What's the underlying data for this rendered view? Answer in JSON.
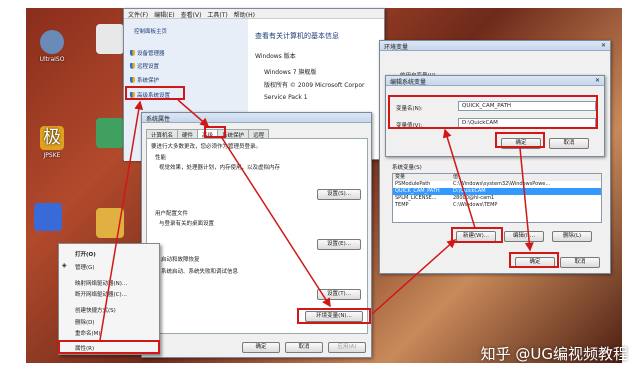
{
  "desktop_icons": [
    {
      "label": "UltraISO",
      "color": "#6a8ab8"
    },
    {
      "label": "JPSKE",
      "color": "#e0a020"
    },
    {
      "label": "",
      "color": "#3a6ad8"
    },
    {
      "label": "",
      "color": "#e8e8e8"
    },
    {
      "label": "",
      "color": "#40a060"
    },
    {
      "label": "",
      "color": "#e0b040"
    }
  ],
  "control_panel": {
    "menu": [
      "文件(F)",
      "编辑(E)",
      "查看(V)",
      "工具(T)",
      "帮助(H)"
    ],
    "nav": [
      "控制面板主页",
      "设备管理器",
      "远程设置",
      "系统保护",
      "高级系统设置"
    ],
    "heading": "查看有关计算机的基本信息",
    "edition_label": "Windows 版本",
    "edition": "Windows 7 旗舰版",
    "copyright": "版权所有 © 2009 Microsoft Corpor",
    "service_pack": "Service Pack 1"
  },
  "system_properties": {
    "title": "系统属性",
    "tabs": [
      "计算机名",
      "硬件",
      "高级",
      "系统保护",
      "远程"
    ],
    "admin_note": "要进行大多数更改，您必须作为管理员登录。",
    "perf_title": "性能",
    "perf_desc": "视觉效果，处理器计划，内存使用，以及虚拟内存",
    "settings1": "设置(S)...",
    "profile_title": "用户配置文件",
    "profile_desc": "与登录有关的桌面设置",
    "settings2": "设置(E)...",
    "startup_title": "启动和故障恢复",
    "startup_desc": "系统启动、系统失败和调试信息",
    "settings3": "设置(T)...",
    "env_button": "环境变量(N)...",
    "ok": "确定",
    "cancel": "取消",
    "apply": "应用(A)"
  },
  "env_vars": {
    "title": "环境变量",
    "user_vars_label": "的用户变量(U)",
    "system_vars_label": "系统变量(S)",
    "col_var": "变量",
    "col_val": "值",
    "rows": [
      {
        "name": "PSModulePath",
        "value": "C:\\Windows\\system32\\WindowsPowe..."
      },
      {
        "name": "QUICK_CAM_PATH",
        "value": "D:\\QuickCAM"
      },
      {
        "name": "SPLM_LICENSE...",
        "value": "28000@hl-cam1"
      },
      {
        "name": "TEMP",
        "value": "C:\\Windows\\TEMP"
      }
    ],
    "new_btn": "新建(W)...",
    "edit_btn": "编辑(I)...",
    "delete_btn": "删除(L)",
    "ok": "确定",
    "cancel": "取消"
  },
  "edit_var": {
    "title": "编辑系统变量",
    "name_label": "变量名(N):",
    "name_value": "QUICK_CAM_PATH",
    "value_label": "变量值(V):",
    "value_value": "D:\\QuickCAM",
    "ok": "确定",
    "cancel": "取消"
  },
  "context_menu": {
    "items": [
      "打开(O)",
      "管理(G)",
      "映射网络驱动器(N)...",
      "断开网络驱动器(C)...",
      "创建快捷方式(S)",
      "删除(D)",
      "重命名(M)",
      "属性(R)"
    ]
  },
  "watermark": "知乎 @UG编视频教程",
  "colors": {
    "highlight": "#d01818",
    "link": "#1a3d7a"
  }
}
